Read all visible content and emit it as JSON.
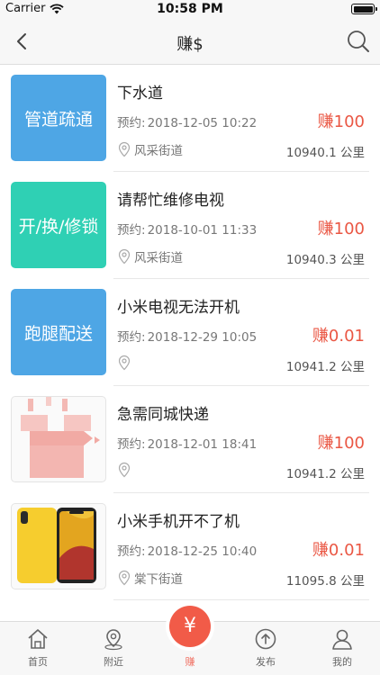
{
  "status_bar": {
    "carrier": "Carrier",
    "time": "10:58 PM"
  },
  "nav": {
    "title": "赚$"
  },
  "appointment_label": "预约:",
  "items": [
    {
      "thumb_text": "管道疏通",
      "thumb_color": "#4ea6e5",
      "title": "下水道",
      "date": "2018-12-05 10:22",
      "reward": "赚100",
      "location": "风采街道",
      "distance": "10940.1 公里"
    },
    {
      "thumb_text": "开/换/修锁",
      "thumb_color": "#2fd0b4",
      "title": "请帮忙维修电视",
      "date": "2018-10-01 11:33",
      "reward": "赚100",
      "location": "风采街道",
      "distance": "10940.3 公里"
    },
    {
      "thumb_text": "跑腿配送",
      "thumb_color": "#4ea6e5",
      "title": "小米电视无法开机",
      "date": "2018-12-29 10:05",
      "reward": "赚0.01",
      "location": "",
      "distance": "10941.2 公里"
    },
    {
      "thumb_text": "",
      "thumb_icon": "package-box-image",
      "title": "急需同城快递",
      "date": "2018-12-01 18:41",
      "reward": "赚100",
      "location": "",
      "distance": "10941.2 公里"
    },
    {
      "thumb_text": "",
      "thumb_icon": "yellow-iphone-image",
      "title": "小米手机开不了机",
      "date": "2018-12-25 10:40",
      "reward": "赚0.01",
      "location": "棠下街道",
      "distance": "11095.8 公里"
    }
  ],
  "tabs": [
    {
      "label": "首页",
      "icon": "home-icon"
    },
    {
      "label": "附近",
      "icon": "location-pin-icon"
    },
    {
      "label": "赚",
      "icon": "yen-icon",
      "active": true
    },
    {
      "label": "发布",
      "icon": "upload-icon"
    },
    {
      "label": "我的",
      "icon": "user-icon"
    }
  ],
  "fab": {
    "symbol": "¥"
  },
  "colors": {
    "accent": "#ea5744",
    "blue": "#4ea6e5",
    "teal": "#2fd0b4"
  }
}
